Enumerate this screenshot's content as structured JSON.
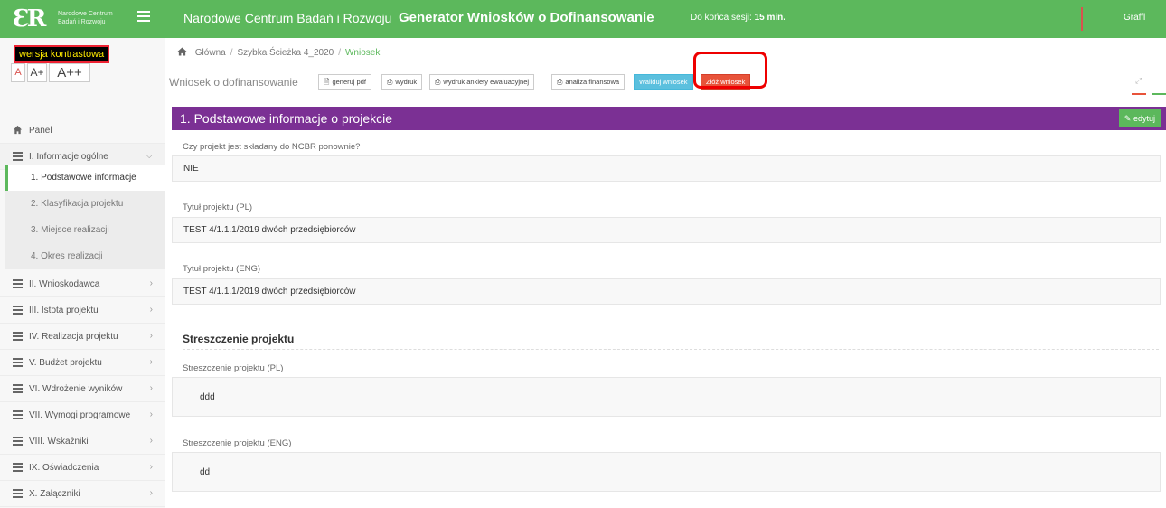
{
  "topbar": {
    "logo_mark": "ƐR",
    "logo_text": "Narodowe Centrum Badań i Rozwoju",
    "brand": "Narodowe Centrum Badań i Rozwoju",
    "app_title": "Generator Wniosków o Dofinansowanie",
    "session_label": "Do końca sesji:",
    "session_value": "15 min.",
    "user": "Graffl",
    "accent_color": "#5cb85c"
  },
  "sidebar": {
    "contrast_label": "wersja kontrastowa",
    "font_small": "A",
    "font_medium": "A+",
    "font_large": "A++",
    "panel_label": "Panel",
    "sections": [
      {
        "label": "I. Informacje ogólne",
        "expanded": true
      },
      {
        "label": "II. Wnioskodawca"
      },
      {
        "label": "III. Istota projektu"
      },
      {
        "label": "IV. Realizacja projektu"
      },
      {
        "label": "V. Budżet projektu"
      },
      {
        "label": "VI. Wdrożenie wyników"
      },
      {
        "label": "VII. Wymogi programowe"
      },
      {
        "label": "VIII. Wskaźniki"
      },
      {
        "label": "IX. Oświadczenia"
      },
      {
        "label": "X. Załączniki"
      }
    ],
    "subitems": [
      {
        "label": "1. Podstawowe informacje",
        "active": true
      },
      {
        "label": "2. Klasyfikacja projektu"
      },
      {
        "label": "3. Miejsce realizacji"
      },
      {
        "label": "4. Okres realizacji"
      }
    ]
  },
  "breadcrumb": {
    "items": [
      "Główna",
      "Szybka Ścieżka 4_2020",
      "Wniosek"
    ]
  },
  "toolbar": {
    "title": "Wniosek o dofinansowanie",
    "generate_pdf": "generuj pdf",
    "print": "wydruk",
    "print_survey": "wydruk ankiety ewaluacyjnej",
    "financial_analysis": "analiza finansowa",
    "validate": "Waliduj wniosek",
    "submit": "Złóż wniosek"
  },
  "panel": {
    "title": "1. Podstawowe informacje o projekcie",
    "edit_label": "edytuj",
    "header_color": "#7b3094"
  },
  "fields": {
    "resubmitted_label": "Czy projekt jest składany do NCBR ponownie?",
    "resubmitted_value": "NIE",
    "title_pl_label": "Tytuł projektu (PL)",
    "title_pl_value": "TEST 4/1.1.1/2019 dwóch przedsiębiorców",
    "title_eng_label": "Tytuł projektu (ENG)",
    "title_eng_value": "TEST 4/1.1.1/2019 dwóch przedsiębiorców",
    "summary_section": "Streszczenie projektu",
    "summary_pl_label": "Streszczenie projektu (PL)",
    "summary_pl_value": "ddd",
    "summary_eng_label": "Streszczenie projektu (ENG)",
    "summary_eng_value": "dd"
  }
}
